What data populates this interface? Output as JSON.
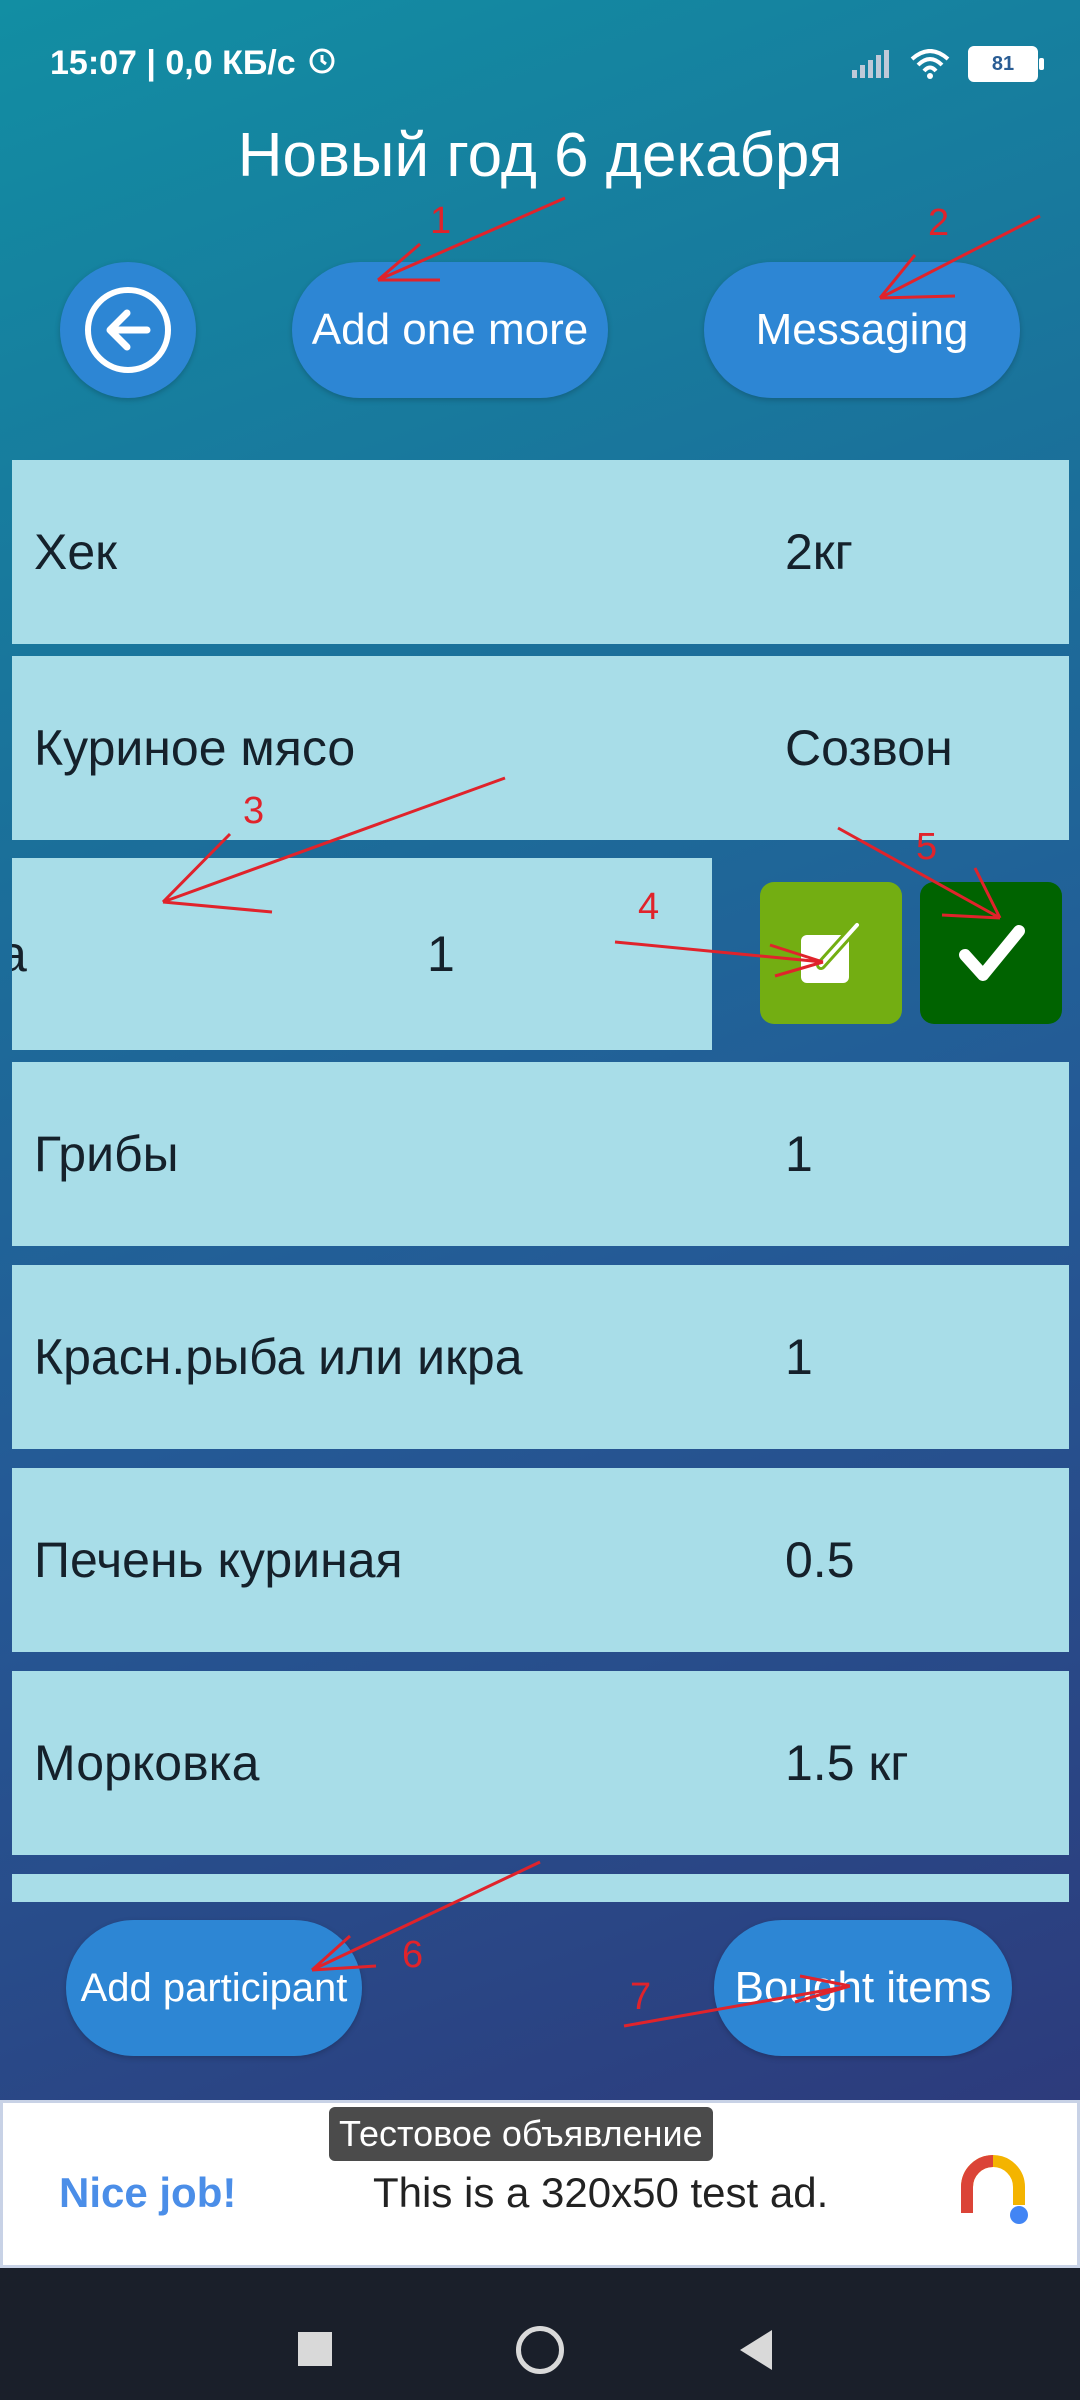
{
  "status_bar": {
    "time": "15:07 | 0,0 КБ/с",
    "battery": "81"
  },
  "header": {
    "title": "Новый год 6 декабря"
  },
  "buttons": {
    "add_one_more": "Add one more",
    "messaging": "Messaging",
    "add_participant": "Add participant",
    "bought_items": "Bought items"
  },
  "list": {
    "rows": [
      {
        "name": "Хек",
        "qty": "2кг"
      },
      {
        "name": "Куриное мясо",
        "qty": "Созвон"
      },
      {
        "name": "дра",
        "qty": "1"
      },
      {
        "name": "Грибы",
        "qty": "1"
      },
      {
        "name": "Красн.рыба или икра",
        "qty": "1"
      },
      {
        "name": "Печень куриная",
        "qty": "0.5"
      },
      {
        "name": "Морковка",
        "qty": "1.5 кг"
      }
    ]
  },
  "annotations": [
    "1",
    "2",
    "3",
    "4",
    "5",
    "6",
    "7"
  ],
  "ad": {
    "label": "Тестовое объявление",
    "headline": "Nice job!",
    "text": "This is a 320x50 test ad."
  },
  "colors": {
    "button": "#2d86d4",
    "row": "#a8dde8",
    "edit": "#73ae12",
    "done": "#006300",
    "annotation": "#e0232b"
  }
}
